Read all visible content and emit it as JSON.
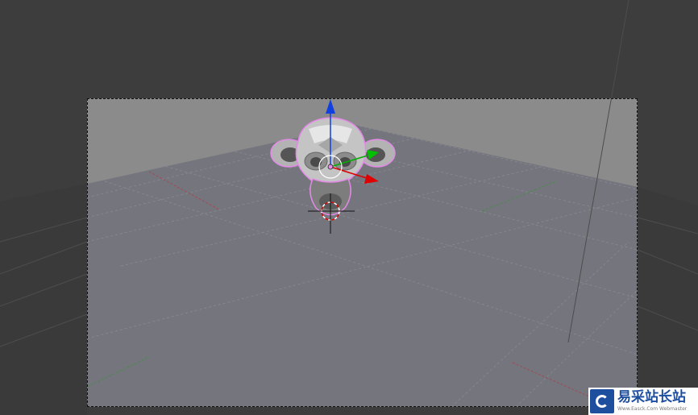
{
  "watermark": {
    "title": "易采站长站",
    "subtitle": "Www.Easck.Com Webmaster",
    "logo_icon": "easck-logo-icon"
  },
  "viewport": {
    "background_color": "#3d3d3d",
    "backdrop_color": "#8a8a8a",
    "floor_color": "#73737c",
    "selection_outline_color": "#e38ae6",
    "gizmo_colors": {
      "x": "#e00000",
      "y": "#00b000",
      "z": "#1040e0"
    }
  }
}
